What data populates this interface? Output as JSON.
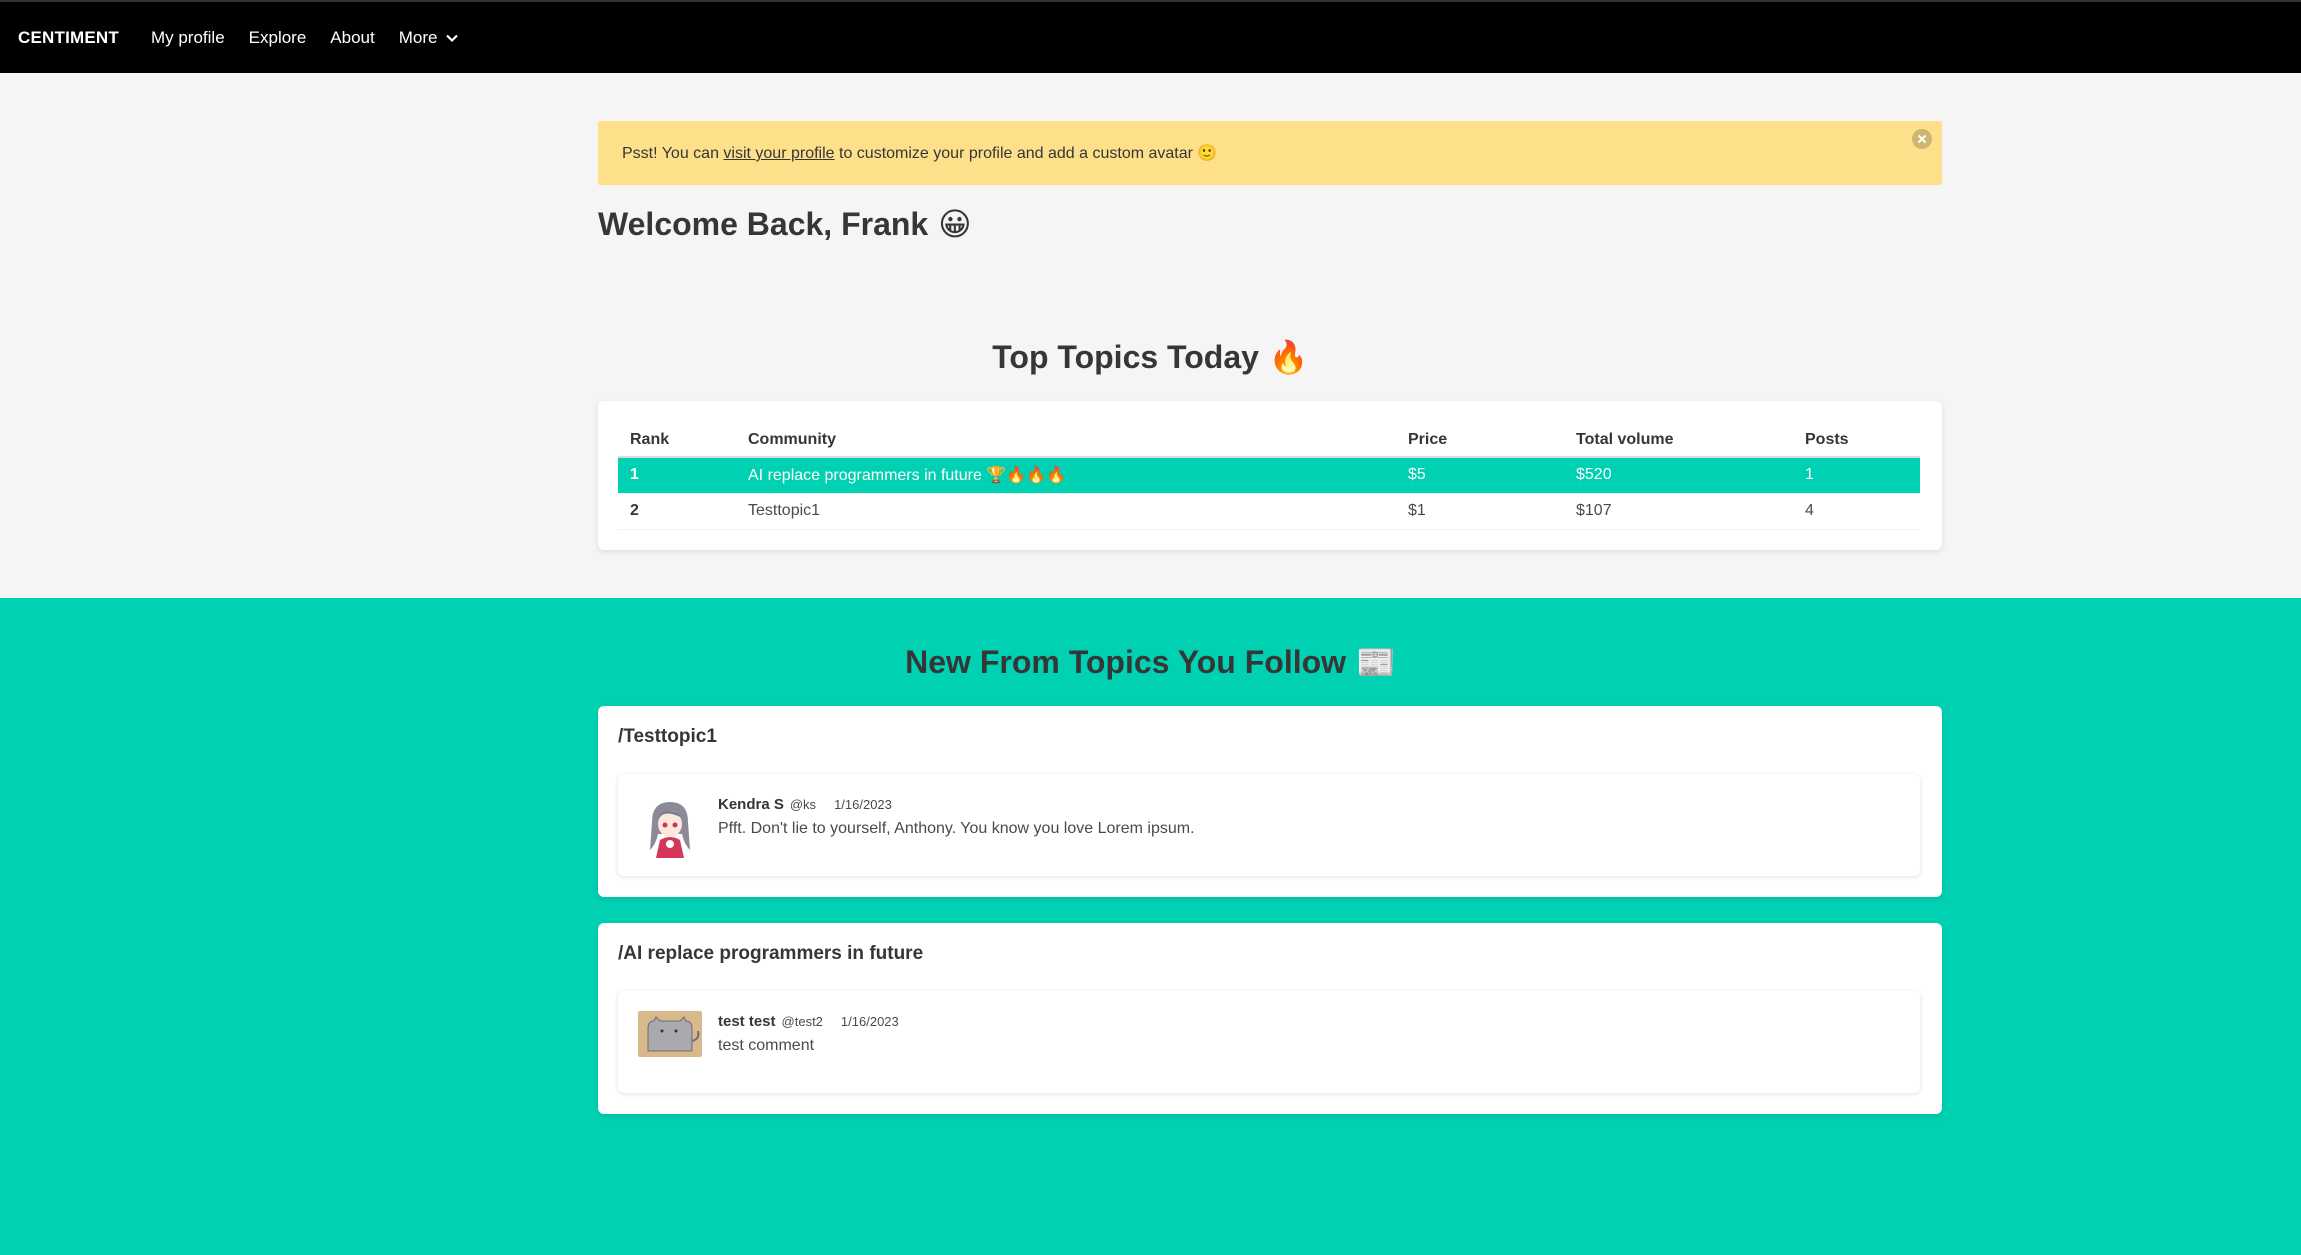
{
  "nav": {
    "brand": "CENTIMENT",
    "items": [
      "My profile",
      "Explore",
      "About",
      "More"
    ]
  },
  "notice": {
    "prefix": "Psst! You can ",
    "link": "visit your profile",
    "suffix": " to customize your profile and add a custom avatar 🙂"
  },
  "welcome": {
    "text": "Welcome Back, Frank",
    "emoji": "😀"
  },
  "top_topics": {
    "title": "Top Topics Today",
    "emoji": "🔥",
    "columns": [
      "Rank",
      "Community",
      "Price",
      "Total volume",
      "Posts"
    ],
    "rows": [
      {
        "rank": "1",
        "community": "AI replace programmers in future 🏆🔥🔥🔥",
        "price": "$5",
        "volume": "$520",
        "posts": "1"
      },
      {
        "rank": "2",
        "community": "Testtopic1",
        "price": "$1",
        "volume": "$107",
        "posts": "4"
      }
    ]
  },
  "following": {
    "title": "New From Topics You Follow",
    "emoji": "📰",
    "topics": [
      {
        "title": "/Testtopic1",
        "post": {
          "name": "Kendra S",
          "handle": "@ks",
          "date": "1/16/2023",
          "text": "Pfft. Don't lie to yourself, Anthony. You know you love Lorem ipsum."
        }
      },
      {
        "title": "/AI replace programmers in future",
        "post": {
          "name": "test test",
          "handle": "@test2",
          "date": "1/16/2023",
          "text": "test comment"
        }
      }
    ]
  },
  "colors": {
    "primary": "#00d1b2",
    "warning": "#ffe08a",
    "navbar": "#000000"
  }
}
